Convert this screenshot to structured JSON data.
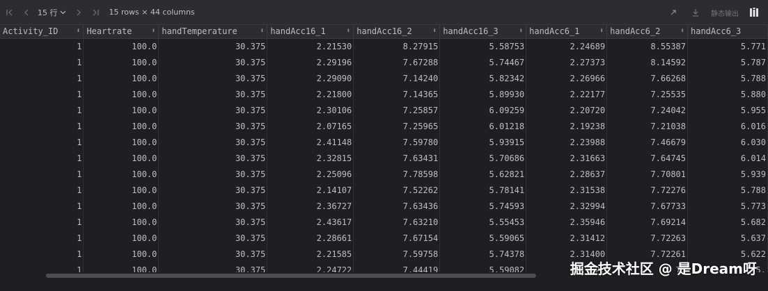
{
  "toolbar": {
    "rows_selector": "15 行",
    "rows_summary": "15 rows × 44 columns",
    "static_output_label": "静态输出"
  },
  "table": {
    "columns": [
      "Activity_ID",
      "Heartrate",
      "handTemperature",
      "handAcc16_1",
      "handAcc16_2",
      "handAcc16_3",
      "handAcc6_1",
      "handAcc6_2",
      "handAcc6_3"
    ],
    "rows": [
      [
        "1",
        "100.0",
        "30.375",
        "2.21530",
        "8.27915",
        "5.58753",
        "2.24689",
        "8.55387",
        "5.771"
      ],
      [
        "1",
        "100.0",
        "30.375",
        "2.29196",
        "7.67288",
        "5.74467",
        "2.27373",
        "8.14592",
        "5.787"
      ],
      [
        "1",
        "100.0",
        "30.375",
        "2.29090",
        "7.14240",
        "5.82342",
        "2.26966",
        "7.66268",
        "5.788"
      ],
      [
        "1",
        "100.0",
        "30.375",
        "2.21800",
        "7.14365",
        "5.89930",
        "2.22177",
        "7.25535",
        "5.880"
      ],
      [
        "1",
        "100.0",
        "30.375",
        "2.30106",
        "7.25857",
        "6.09259",
        "2.20720",
        "7.24042",
        "5.955"
      ],
      [
        "1",
        "100.0",
        "30.375",
        "2.07165",
        "7.25965",
        "6.01218",
        "2.19238",
        "7.21038",
        "6.016"
      ],
      [
        "1",
        "100.0",
        "30.375",
        "2.41148",
        "7.59780",
        "5.93915",
        "2.23988",
        "7.46679",
        "6.030"
      ],
      [
        "1",
        "100.0",
        "30.375",
        "2.32815",
        "7.63431",
        "5.70686",
        "2.31663",
        "7.64745",
        "6.014"
      ],
      [
        "1",
        "100.0",
        "30.375",
        "2.25096",
        "7.78598",
        "5.62821",
        "2.28637",
        "7.70801",
        "5.939"
      ],
      [
        "1",
        "100.0",
        "30.375",
        "2.14107",
        "7.52262",
        "5.78141",
        "2.31538",
        "7.72276",
        "5.788"
      ],
      [
        "1",
        "100.0",
        "30.375",
        "2.36727",
        "7.63436",
        "5.74593",
        "2.32994",
        "7.67733",
        "5.773"
      ],
      [
        "1",
        "100.0",
        "30.375",
        "2.43617",
        "7.63210",
        "5.55453",
        "2.35946",
        "7.69214",
        "5.682"
      ],
      [
        "1",
        "100.0",
        "30.375",
        "2.28661",
        "7.67154",
        "5.59065",
        "2.31412",
        "7.72263",
        "5.637"
      ],
      [
        "1",
        "100.0",
        "30.375",
        "2.21585",
        "7.59758",
        "5.74378",
        "2.31400",
        "7.72261",
        "5.622"
      ],
      [
        "1",
        "100.0",
        "30.375",
        "2.24722",
        "7.44419",
        "5.59082",
        "2.",
        "7.",
        "5."
      ]
    ]
  },
  "watermark": "掘金技术社区 @ 是Dream呀",
  "colors": {
    "background": "#1e1f22",
    "toolbar": "#2b2d30",
    "text": "#bcbec4",
    "muted": "#6f737a"
  }
}
